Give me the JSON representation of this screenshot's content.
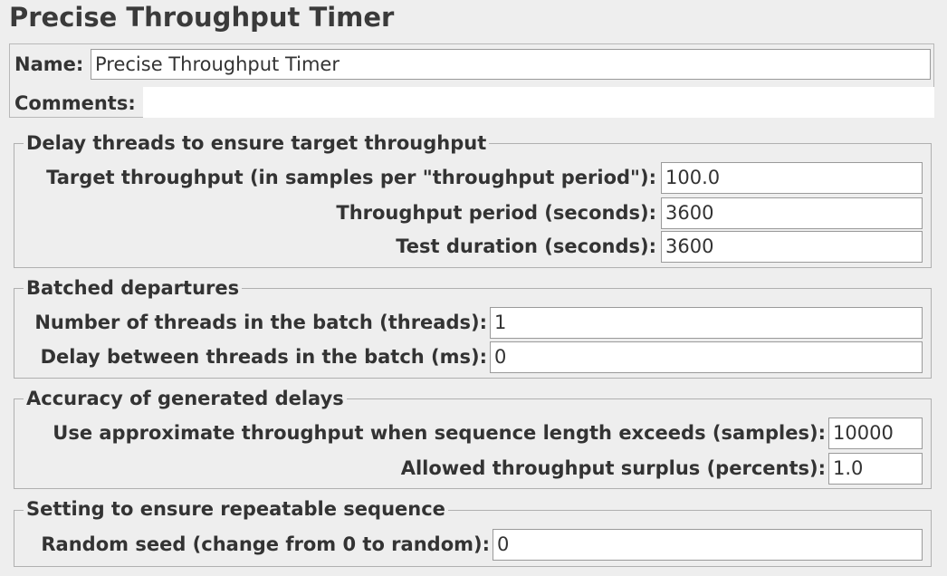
{
  "title": "Precise Throughput Timer",
  "name": {
    "label": "Name:",
    "value": "Precise Throughput Timer"
  },
  "comments": {
    "label": "Comments:",
    "value": ""
  },
  "groups": [
    {
      "title": "Delay threads to ensure target throughput",
      "fields": [
        {
          "label": "Target throughput (in samples per \"throughput period\"):",
          "value": "100.0"
        },
        {
          "label": "Throughput period (seconds):",
          "value": "3600"
        },
        {
          "label": "Test duration (seconds):",
          "value": "3600"
        }
      ]
    },
    {
      "title": "Batched departures",
      "fields": [
        {
          "label": "Number of threads in the batch (threads):",
          "value": "1"
        },
        {
          "label": "Delay between threads in the batch (ms):",
          "value": "0"
        }
      ]
    },
    {
      "title": "Accuracy of generated delays",
      "fields": [
        {
          "label": "Use approximate throughput when sequence length exceeds (samples):",
          "value": "10000"
        },
        {
          "label": "Allowed throughput surplus (percents):",
          "value": "1.0"
        }
      ]
    },
    {
      "title": "Setting to ensure repeatable sequence",
      "fields": [
        {
          "label": "Random seed (change from 0 to random):",
          "value": "0"
        }
      ]
    }
  ]
}
